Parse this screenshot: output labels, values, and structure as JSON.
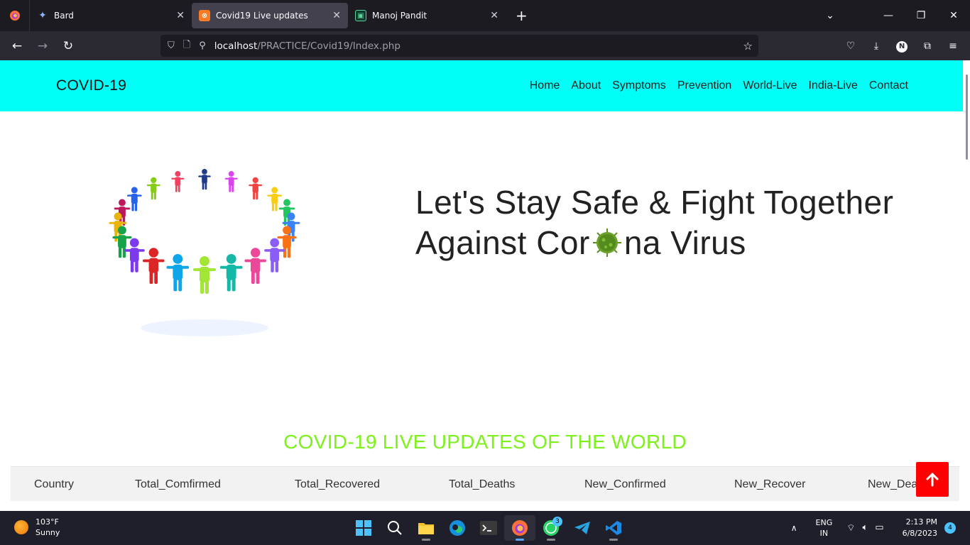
{
  "browser": {
    "tabs": [
      {
        "title": "Bard",
        "icon": "sparkle-icon",
        "active": false
      },
      {
        "title": "Covid19 Live updates",
        "icon": "xampp-icon",
        "active": true
      },
      {
        "title": "Manoj Pandit",
        "icon": "terminal-icon",
        "active": false
      }
    ],
    "url_host": "localhost",
    "url_path": "/PRACTICE/Covid19/Index.php",
    "account_initial": "N"
  },
  "site": {
    "brand": "COVID-19",
    "nav": [
      "Home",
      "About",
      "Symptoms",
      "Prevention",
      "World-Live",
      "India-Live",
      "Contact"
    ],
    "hero_line1": "Let's Stay Safe & Fight Together",
    "hero_line2_a": "Against Cor",
    "hero_line2_b": "na Virus",
    "live_title": "COVID-19 LIVE UPDATES OF THE WORLD",
    "table_headers": [
      "Country",
      "Total_Comfirmed",
      "Total_Recovered",
      "Total_Deaths",
      "New_Confirmed",
      "New_Recover",
      "New_Deaths"
    ],
    "colors": {
      "header_bg": "#00fff7",
      "live_title": "#7cf21a",
      "to_top": "#ff0000"
    }
  },
  "taskbar": {
    "temp": "103°F",
    "weather": "Sunny",
    "whatsapp_badge": "3",
    "lang_top": "ENG",
    "lang_bottom": "IN",
    "time": "2:13 PM",
    "date": "6/8/2023",
    "notifications": "4"
  }
}
